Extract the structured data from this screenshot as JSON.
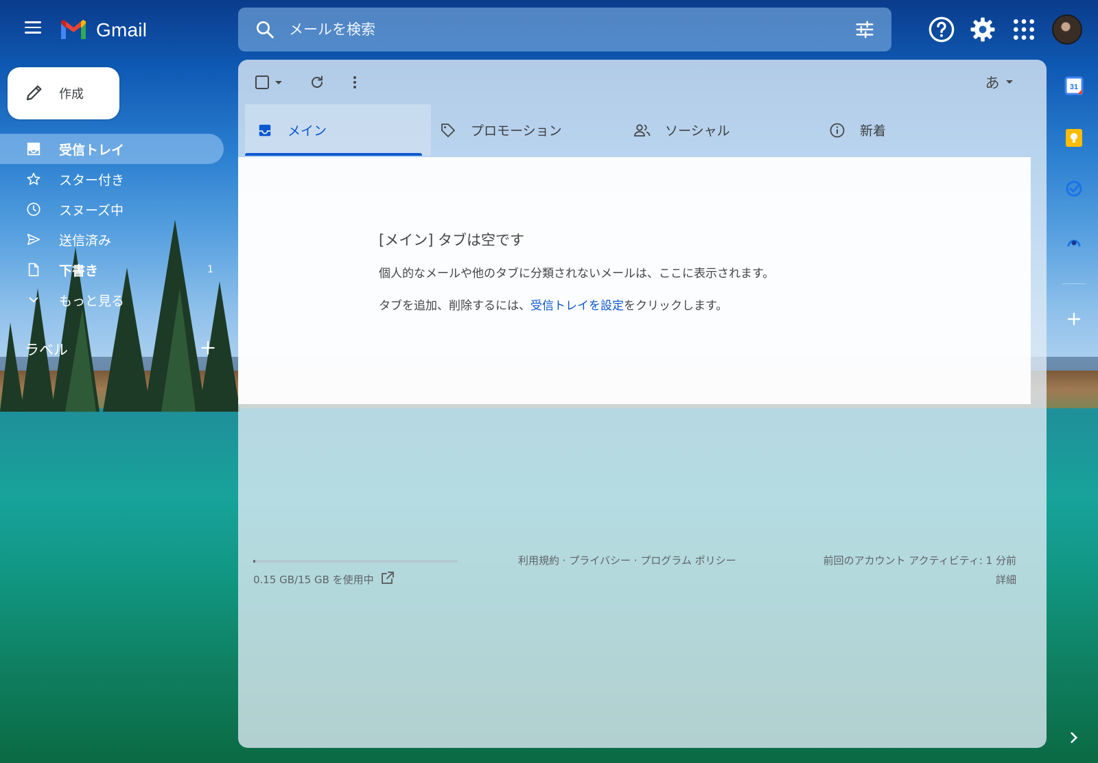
{
  "app": {
    "brand": "Gmail"
  },
  "search": {
    "placeholder": "メールを検索"
  },
  "compose": {
    "label": "作成"
  },
  "sidebar": {
    "items": [
      {
        "label": "受信トレイ",
        "icon": "inbox-icon",
        "active": true
      },
      {
        "label": "スター付き",
        "icon": "star-icon"
      },
      {
        "label": "スヌーズ中",
        "icon": "clock-icon"
      },
      {
        "label": "送信済み",
        "icon": "send-icon"
      },
      {
        "label": "下書き",
        "icon": "draft-icon",
        "count": "1"
      },
      {
        "label": "もっと見る",
        "icon": "chevron-down-icon"
      }
    ],
    "labels_title": "ラベル"
  },
  "toolbar": {
    "input_method": "あ"
  },
  "tabs": [
    {
      "label": "メイン",
      "icon": "inbox-tab-icon",
      "active": true
    },
    {
      "label": "プロモーション",
      "icon": "tag-icon"
    },
    {
      "label": "ソーシャル",
      "icon": "people-icon"
    },
    {
      "label": "新着",
      "icon": "info-icon"
    }
  ],
  "empty_state": {
    "title": "[メイン] タブは空です",
    "line1": "個人的なメールや他のタブに分類されないメールは、ここに表示されます。",
    "line2_prefix": "タブを追加、削除するには、",
    "line2_link": "受信トレイを設定",
    "line2_suffix": "をクリックします。"
  },
  "footer": {
    "storage_used": 0.15,
    "storage_total": 15,
    "storage_text": "0.15 GB/15 GB を使用中",
    "policies": "利用規約 · プライバシー · プログラム ポリシー",
    "last_activity": "前回のアカウント アクティビティ: 1 分前",
    "details": "詳細"
  },
  "side_apps": {
    "calendar_day": "31"
  },
  "colors": {
    "accent": "#0b57d0",
    "text_secondary": "#5f6368",
    "active_nav": "#96c3f0",
    "keep": "#fbbc04"
  }
}
